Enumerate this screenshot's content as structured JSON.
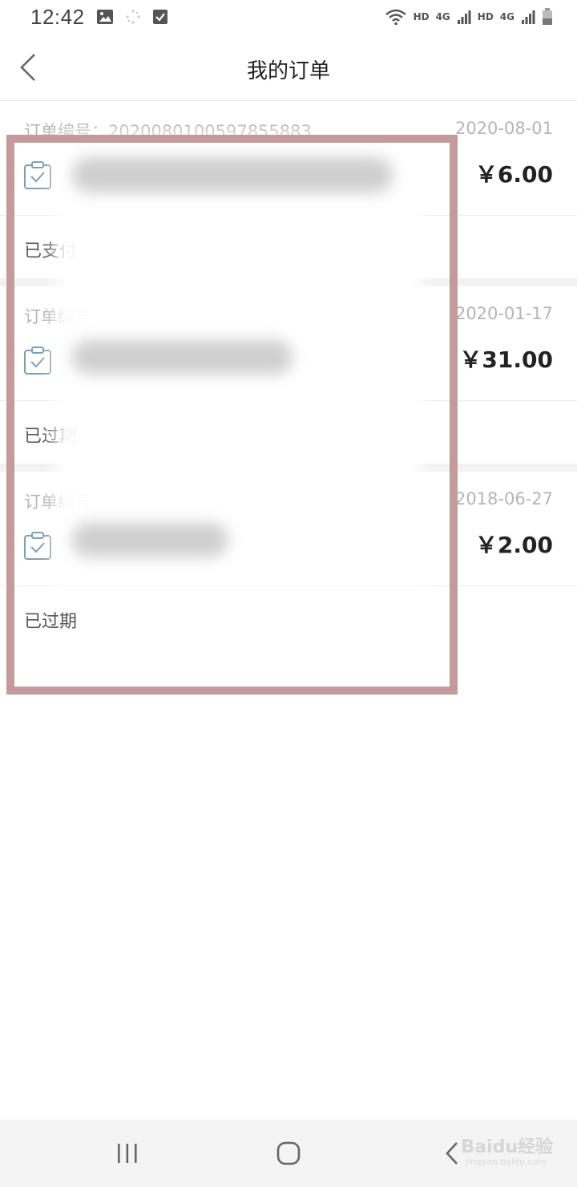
{
  "status_bar": {
    "time": "12:42",
    "network_labels": [
      "HD",
      "4G",
      "HD",
      "4G"
    ],
    "icons": [
      "image-icon",
      "loading-icon",
      "checkbox-icon",
      "wifi-icon",
      "signal-icon",
      "battery-icon"
    ]
  },
  "header": {
    "title": "我的订单",
    "back_icon": "chevron-left-icon"
  },
  "orders": [
    {
      "number": "订单编号：2020080100597855883",
      "date": "2020-08-01",
      "price": "￥6.00",
      "status": "已支付"
    },
    {
      "number": "订单编号",
      "date": "2020-01-17",
      "price": "￥31.00",
      "status": "已过期"
    },
    {
      "number": "订单编号",
      "date": "2018-06-27",
      "price": "￥2.00",
      "status": "已过期"
    }
  ],
  "nav_bar": {
    "icons": [
      "recent-apps-icon",
      "home-icon",
      "back-icon"
    ]
  },
  "watermark": {
    "text": "Baidu经验",
    "sub": "jingyan.baidu.com"
  },
  "colors": {
    "highlight": "#c59a9c",
    "muted_text": "#b5b5b5",
    "icon_blue": "#7aa0b8"
  }
}
